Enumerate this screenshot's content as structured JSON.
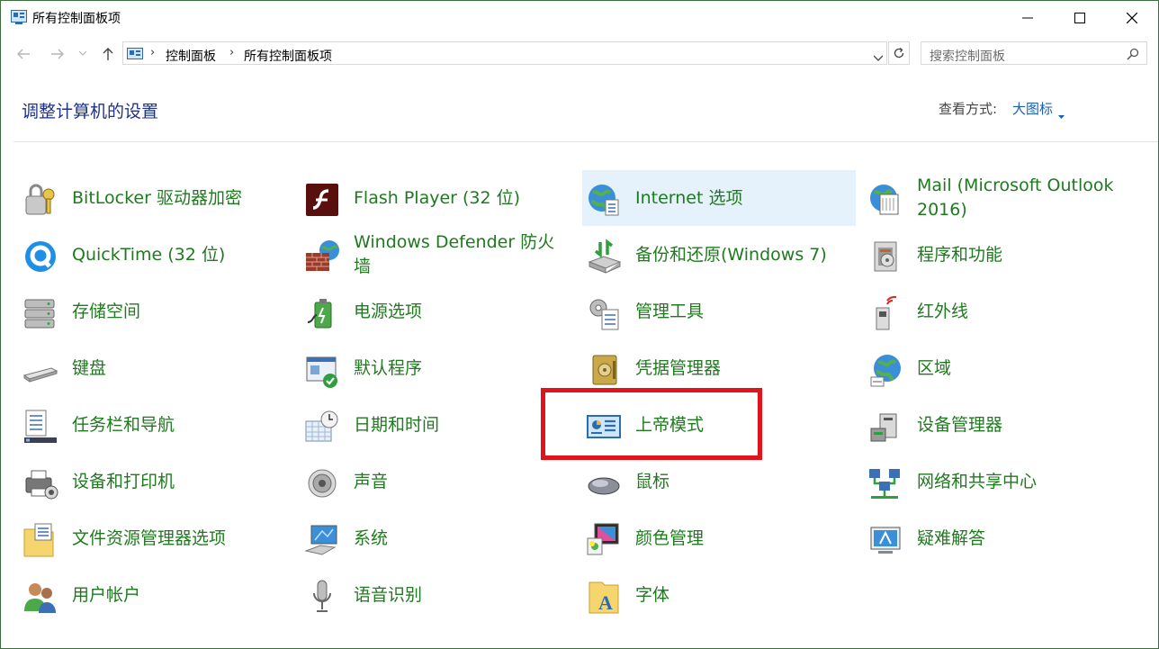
{
  "window": {
    "title": "所有控制面板项"
  },
  "nav": {
    "breadcrumb": [
      "控制面板",
      "所有控制面板项"
    ],
    "search_placeholder": "搜索控制面板"
  },
  "header": {
    "title": "调整计算机的设置",
    "view_by_label": "查看方式:",
    "view_by_value": "大图标"
  },
  "items": [
    {
      "label": "BitLocker 驱动器加密",
      "icon": "bitlocker-icon"
    },
    {
      "label": "Flash Player (32 位)",
      "icon": "flash-icon"
    },
    {
      "label": "Internet 选项",
      "icon": "internet-globe-icon"
    },
    {
      "label": "Mail (Microsoft Outlook 2016)",
      "icon": "mail-icon"
    },
    {
      "label": "QuickTime (32 位)",
      "icon": "quicktime-icon"
    },
    {
      "label": "Windows Defender 防火墙",
      "icon": "firewall-icon"
    },
    {
      "label": "备份和还原(Windows 7)",
      "icon": "backup-icon"
    },
    {
      "label": "程序和功能",
      "icon": "programs-icon"
    },
    {
      "label": "存储空间",
      "icon": "storage-icon"
    },
    {
      "label": "电源选项",
      "icon": "power-icon"
    },
    {
      "label": "管理工具",
      "icon": "admin-tools-icon"
    },
    {
      "label": "红外线",
      "icon": "infrared-icon"
    },
    {
      "label": "键盘",
      "icon": "keyboard-icon"
    },
    {
      "label": "默认程序",
      "icon": "default-programs-icon"
    },
    {
      "label": "凭据管理器",
      "icon": "credential-icon"
    },
    {
      "label": "区域",
      "icon": "region-icon"
    },
    {
      "label": "任务栏和导航",
      "icon": "taskbar-icon"
    },
    {
      "label": "日期和时间",
      "icon": "datetime-icon"
    },
    {
      "label": "上帝模式",
      "icon": "godmode-icon"
    },
    {
      "label": "设备管理器",
      "icon": "device-manager-icon"
    },
    {
      "label": "设备和打印机",
      "icon": "printer-icon"
    },
    {
      "label": "声音",
      "icon": "sound-icon"
    },
    {
      "label": "鼠标",
      "icon": "mouse-icon"
    },
    {
      "label": "网络和共享中心",
      "icon": "network-icon"
    },
    {
      "label": "文件资源管理器选项",
      "icon": "folder-options-icon"
    },
    {
      "label": "系统",
      "icon": "system-icon"
    },
    {
      "label": "颜色管理",
      "icon": "color-icon"
    },
    {
      "label": "疑难解答",
      "icon": "troubleshoot-icon"
    },
    {
      "label": "用户帐户",
      "icon": "users-icon"
    },
    {
      "label": "语音识别",
      "icon": "microphone-icon"
    },
    {
      "label": "字体",
      "icon": "fonts-icon"
    }
  ],
  "colors": {
    "link_green": "#1f7a1f",
    "heading_blue": "#1e3287",
    "highlight_red": "#e0141a",
    "selection_bg": "#e5f1fb"
  }
}
